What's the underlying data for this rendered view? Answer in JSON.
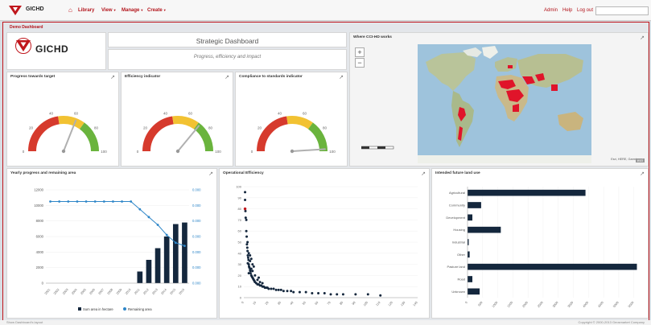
{
  "app": {
    "brand": "GICHD",
    "nav": [
      {
        "label": "Library"
      },
      {
        "label": "View",
        "dropdown": true
      },
      {
        "label": "Manage",
        "dropdown": true
      },
      {
        "label": "Create",
        "dropdown": true
      }
    ],
    "right_links": [
      "Admin",
      "Help",
      "Log out"
    ],
    "search_value": ""
  },
  "breadcrumb": "Demo Dashboard",
  "header": {
    "logo_text": "GICHD",
    "title": "Strategic Dashboard",
    "subtitle": "Progress, efficiency and impact"
  },
  "gauges": [
    {
      "title": "Progress towards target",
      "value": 0.62,
      "labels": [
        "0",
        "20",
        "40",
        "60",
        "80",
        "100"
      ]
    },
    {
      "title": "Efficiency indicator",
      "value": 0.72,
      "labels": [
        "0",
        "20",
        "40",
        "60",
        "80",
        "100"
      ]
    },
    {
      "title": "Compliance to standards indicator",
      "value": 0.98,
      "labels": [
        "0",
        "20",
        "40",
        "60",
        "80",
        "100"
      ]
    }
  ],
  "map": {
    "title": "Where CCI-HD works",
    "copyright": "Esri, HERE, Garmin",
    "credit": "esri",
    "highlight_color": "#e0142a"
  },
  "colors": {
    "accent": "#c0161c",
    "bar_dark": "#14273d",
    "line_blue": "#2e86c8",
    "gauge_red": "#d63a2d",
    "gauge_yellow": "#f2c232",
    "gauge_green": "#6ab43d"
  },
  "charts": [
    {
      "title": "Yearly progress and remaining area",
      "legend": [
        "Sum area in hectare",
        "Remaining area"
      ],
      "chart_data": {
        "type": "bar",
        "categories": [
          "2001",
          "2002",
          "2003",
          "2004",
          "2005",
          "2006",
          "2007",
          "2008",
          "2009",
          "2010",
          "2011",
          "2012",
          "2013",
          "2014",
          "2015",
          "2016"
        ],
        "series": [
          {
            "name": "Sum area in hectare",
            "type": "bar",
            "values": [
              0,
              0,
              0,
              0,
              0,
              0,
              0,
              0,
              0,
              0,
              1500,
              3000,
              4500,
              6000,
              7600,
              7800
            ]
          },
          {
            "name": "Remaining area",
            "type": "line",
            "values": [
              1.05,
              1.05,
              1.05,
              1.05,
              1.05,
              1.05,
              1.05,
              1.05,
              1.05,
              1.05,
              0.95,
              0.85,
              0.75,
              0.62,
              0.52,
              0.48
            ]
          }
        ],
        "y_left_ticks": [
          "0",
          "2000",
          "4000",
          "6000",
          "8000",
          "10000",
          "12000"
        ],
        "y_right_ticks": [
          "0.000",
          "0.000",
          "0.000",
          "0.000",
          "0.000",
          "0.000",
          "0.000"
        ],
        "ylim_left": [
          0,
          12000
        ],
        "ylim_right": [
          0,
          1.2
        ]
      }
    },
    {
      "title": "Operational Efficiency",
      "chart_data": {
        "type": "scatter",
        "points": [
          [
            1,
            95
          ],
          [
            1,
            88
          ],
          [
            1.3,
            78
          ],
          [
            1.5,
            72
          ],
          [
            2,
            60
          ],
          [
            2.3,
            55
          ],
          [
            2.5,
            48
          ],
          [
            3,
            42
          ],
          [
            3.2,
            38
          ],
          [
            3.5,
            36
          ],
          [
            3.8,
            34
          ],
          [
            4,
            30
          ],
          [
            4.2,
            28
          ],
          [
            4.5,
            27
          ],
          [
            5,
            25
          ],
          [
            5.2,
            24
          ],
          [
            5.5,
            22
          ],
          [
            6,
            20
          ],
          [
            6.5,
            19
          ],
          [
            7,
            18
          ],
          [
            7.5,
            17
          ],
          [
            8,
            16
          ],
          [
            8.5,
            15
          ],
          [
            9,
            14
          ],
          [
            10,
            13
          ],
          [
            11,
            12
          ],
          [
            12,
            12
          ],
          [
            13,
            11
          ],
          [
            14,
            11
          ],
          [
            15,
            10
          ],
          [
            16,
            10
          ],
          [
            17,
            9
          ],
          [
            18,
            9
          ],
          [
            19,
            9
          ],
          [
            20,
            8
          ],
          [
            22,
            8
          ],
          [
            24,
            8
          ],
          [
            26,
            7
          ],
          [
            28,
            7
          ],
          [
            30,
            7
          ],
          [
            32,
            6
          ],
          [
            35,
            6
          ],
          [
            38,
            6
          ],
          [
            40,
            5
          ],
          [
            45,
            5
          ],
          [
            50,
            5
          ],
          [
            55,
            4
          ],
          [
            60,
            4
          ],
          [
            65,
            4
          ],
          [
            70,
            3
          ],
          [
            75,
            3
          ],
          [
            80,
            3
          ],
          [
            90,
            3
          ],
          [
            100,
            3
          ],
          [
            110,
            2
          ],
          [
            4,
            22
          ],
          [
            6,
            26
          ],
          [
            8,
            28
          ],
          [
            12,
            18
          ],
          [
            3,
            50
          ],
          [
            2,
            70
          ],
          [
            2.8,
            45
          ],
          [
            3.2,
            31
          ],
          [
            5,
            33
          ],
          [
            7,
            24
          ],
          [
            9,
            20
          ],
          [
            11,
            16
          ],
          [
            13,
            14
          ],
          [
            15,
            13
          ],
          [
            4,
            40
          ],
          [
            6,
            35
          ],
          [
            5,
            38
          ],
          [
            7,
            30
          ]
        ],
        "highlight_point": [
          1,
          80
        ],
        "x_ticks": [
          "0",
          "10",
          "20",
          "30",
          "40",
          "50",
          "60",
          "70",
          "80",
          "90",
          "100",
          "110",
          "120",
          "130",
          "140"
        ],
        "y_ticks": [
          "0",
          "10",
          "20",
          "30",
          "40",
          "50",
          "60",
          "70",
          "80",
          "90",
          "100"
        ],
        "xlim": [
          0,
          140
        ],
        "ylim": [
          0,
          100
        ]
      }
    },
    {
      "title": "Intended future land use",
      "chart_data": {
        "type": "bar",
        "orientation": "horizontal",
        "categories": [
          "Agricultural",
          "Community",
          "Development",
          "Housing",
          "Industrial",
          "Other",
          "Pasture land",
          "Road",
          "Unknown"
        ],
        "values": [
          3900,
          450,
          160,
          1100,
          40,
          70,
          5600,
          160,
          400
        ],
        "x_ticks": [
          "0",
          "500",
          "1000",
          "1500",
          "2000",
          "2500",
          "3000",
          "3500",
          "4000",
          "4500",
          "5000",
          "5500"
        ],
        "xlim": [
          0,
          5800
        ]
      }
    }
  ],
  "footer": {
    "left": "Show Dashboard's layout",
    "right": "Copyright © 2000-2013 Geosmarket Company"
  }
}
